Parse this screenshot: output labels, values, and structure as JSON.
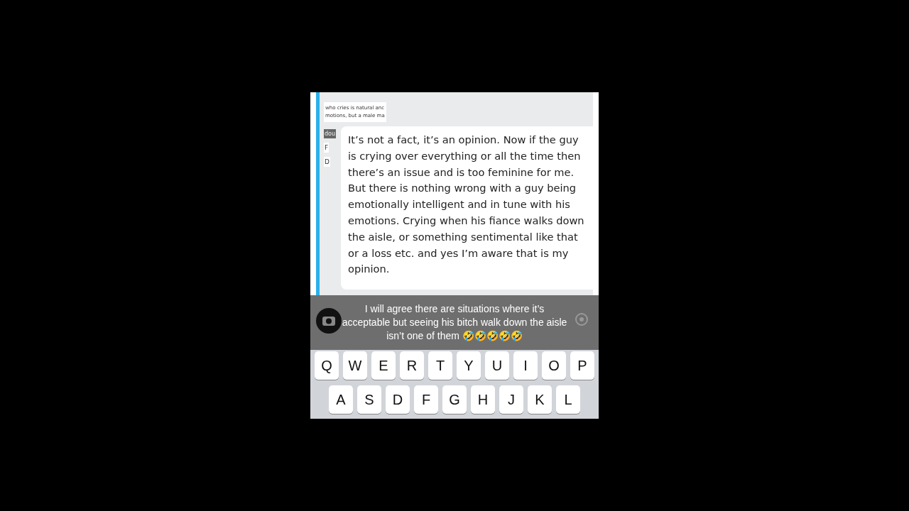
{
  "quoted_snippet": {
    "lines": [
      "who cries is natural anc",
      "motions, but a male ma"
    ]
  },
  "side_fragments": [
    {
      "kind": "tag",
      "text": "dou"
    },
    {
      "kind": "letter",
      "text": "F"
    },
    {
      "kind": "letter",
      "text": "D"
    }
  ],
  "reply_bubble": {
    "text": "It’s not a fact, it’s an opinion. Now if the guy is crying over everything or all the time then there’s an issue and is too feminine for me. But there is nothing wrong with a guy being emotionally intelligent and in tune with his emotions. Crying when his fiance walks down the aisle, or something sentimental like that or a loss etc. and yes I’m aware that is my opinion."
  },
  "caption": {
    "text": "I will agree there are situations where it’s acceptable but seeing his bitch walk down the aisle isn’t one of them 🤣🤣🤣🤣🤣"
  },
  "keyboard": {
    "rows": [
      [
        "Q",
        "W",
        "E",
        "R",
        "T",
        "Y",
        "U",
        "I",
        "O",
        "P"
      ],
      [
        "A",
        "S",
        "D",
        "F",
        "G",
        "H",
        "J",
        "K",
        "L"
      ]
    ]
  }
}
